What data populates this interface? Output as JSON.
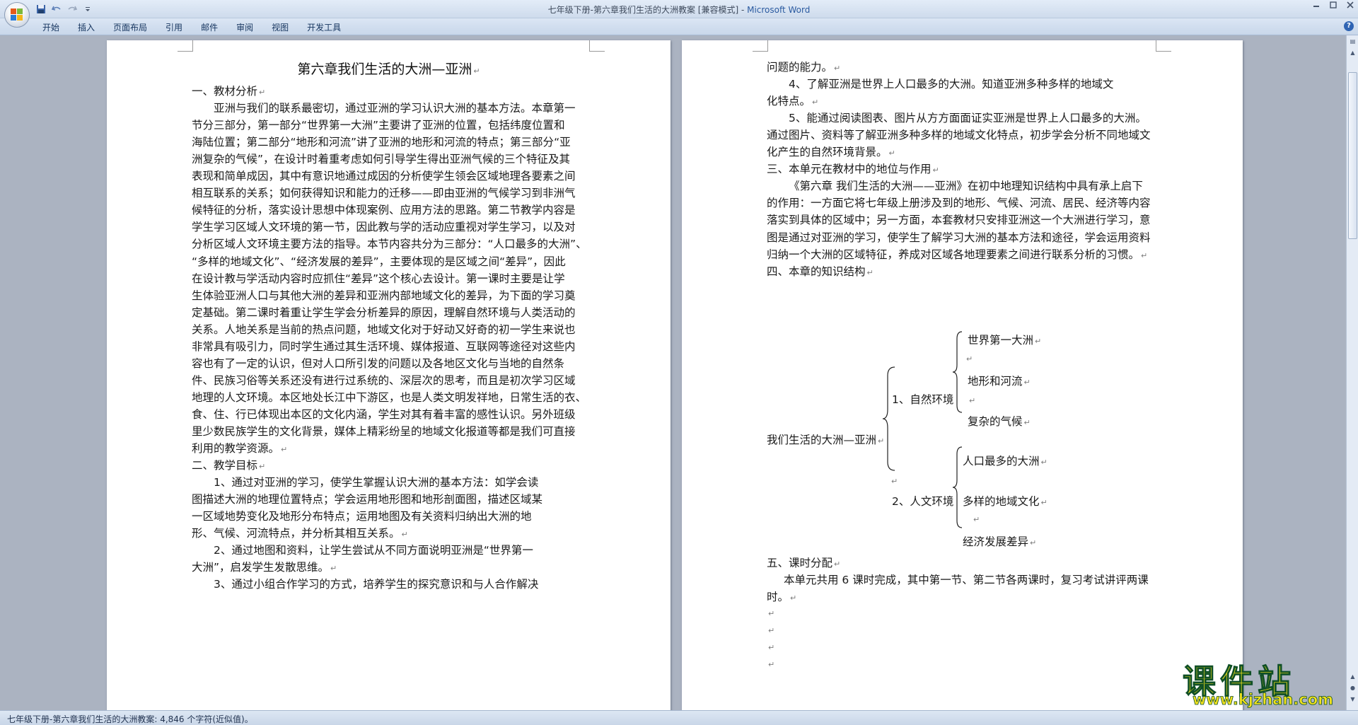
{
  "window": {
    "title": "七年级下册-第六章我们生活的大洲教案 [兼容模式] - ",
    "app_name": "Microsoft Word"
  },
  "quick_access": [
    "save-icon",
    "undo-icon",
    "redo-icon",
    "customize-icon"
  ],
  "ribbon": {
    "tabs": [
      "开始",
      "插入",
      "页面布局",
      "引用",
      "邮件",
      "审阅",
      "视图",
      "开发工具"
    ]
  },
  "document": {
    "title": "第六章我们生活的大洲—亚洲",
    "left_lines": [
      "一、教材分析",
      "亚洲与我们的联系最密切，通过亚洲的学习认识大洲的基本方法。本章第一",
      "节分三部分，第一部分“世界第一大洲”主要讲了亚洲的位置，包括纬度位置和",
      "海陆位置；第二部分“地形和河流”讲了亚洲的地形和河流的特点；第三部分“亚",
      "洲复杂的气候”，在设计时着重考虑如何引导学生得出亚洲气候的三个特征及其",
      "表现和简单成因，其中有意识地通过成因的分析使学生领会区域地理各要素之间",
      "相互联系的关系；如何获得知识和能力的迁移——即由亚洲的气候学习到非洲气",
      "候特征的分析，落实设计思想中体现案例、应用方法的思路。第二节教学内容是",
      "学生学习区域人文环境的第一节，因此教与学的活动应重视对学生学习，以及对",
      "分析区域人文环境主要方法的指导。本节内容共分为三部分：“人口最多的大洲”、",
      "“多样的地域文化”、“经济发展的差异”，主要体现的是区域之间“差异”，因此",
      "在设计教与学活动内容时应抓住“差异”这个核心去设计。第一课时主要是让学",
      "生体验亚洲人口与其他大洲的差异和亚洲内部地域文化的差异，为下面的学习奠",
      "定基础。第二课时着重让学生学会分析差异的原因，理解自然环境与人类活动的",
      "关系。人地关系是当前的热点问题，地域文化对于好动又好奇的初一学生来说也",
      "非常具有吸引力，同时学生通过其生活环境、媒体报道、互联网等途径对这些内",
      "容也有了一定的认识，但对人口所引发的问题以及各地区文化与当地的自然条",
      "件、民族习俗等关系还没有进行过系统的、深层次的思考，而且是初次学习区域",
      "地理的人文环境。本区地处长江中下游区，也是人类文明发祥地，日常生活的衣、",
      "食、住、行已体现出本区的文化内涵，学生对其有着丰富的感性认识。另外班级",
      "里少数民族学生的文化背景，媒体上精彩纷呈的地域文化报道等都是我们可直接",
      "利用的教学资源。",
      "二、教学目标",
      "1、通过对亚洲的学习，使学生掌握认识大洲的基本方法：如学会读",
      "图描述大洲的地理位置特点；学会运用地形图和地形剖面图，描述区域某",
      "一区域地势变化及地形分布特点；运用地图及有关资料归纳出大洲的地",
      "形、气候、河流特点，并分析其相互关系。",
      "2、通过地图和资料，让学生尝试从不同方面说明亚洲是“世界第一",
      "大洲”，启发学生发散思维。",
      "3、通过小组合作学习的方式，培养学生的探究意识和与人合作解决"
    ],
    "right_lines": [
      "问题的能力。",
      "4、了解亚洲是世界上人口最多的大洲。知道亚洲多种多样的地域文",
      "化特点。",
      "5、能通过阅读图表、图片从方方面面证实亚洲是世界上人口最多的大洲。",
      "通过图片、资料等了解亚洲多种多样的地域文化特点，初步学会分析不同地域文",
      "化产生的自然环境背景。",
      "三、本单元在教材中的地位与作用",
      "《第六章 我们生活的大洲——亚洲》在初中地理知识结构中具有承上启下",
      "的作用：一方面它将七年级上册涉及到的地形、气候、河流、居民、经济等内容",
      "落实到具体的区域中；另一方面，本套教材只安排亚洲这一个大洲进行学习，意",
      "图是通过对亚洲的学习，使学生了解学习大洲的基本方法和途径，学会运用资料",
      "归纳一个大洲的区域特征，养成对区域各地理要素之间进行联系分析的习惯。",
      "四、本章的知识结构"
    ],
    "structure": {
      "root": "我们生活的大洲—亚洲",
      "branch1": "1、自然环境",
      "branch1_items": [
        "世界第一大洲",
        "地形和河流",
        "复杂的气候"
      ],
      "branch2": "2、人文环境",
      "branch2_items": [
        "人口最多的大洲",
        "多样的地域文化",
        "经济发展差异"
      ]
    },
    "right_lines_after": [
      "五、课时分配",
      "本单元共用 6 课时完成，其中第一节、第二节各两课时，复习考试讲评两课",
      "时。"
    ],
    "paragraph_mark": "↵"
  },
  "status": {
    "text": "七年级下册-第六章我们生活的大洲教案: 4,846 个字符(近似值)。"
  },
  "watermark": {
    "brand": "课件站",
    "url": "www.kjzhan.com"
  }
}
